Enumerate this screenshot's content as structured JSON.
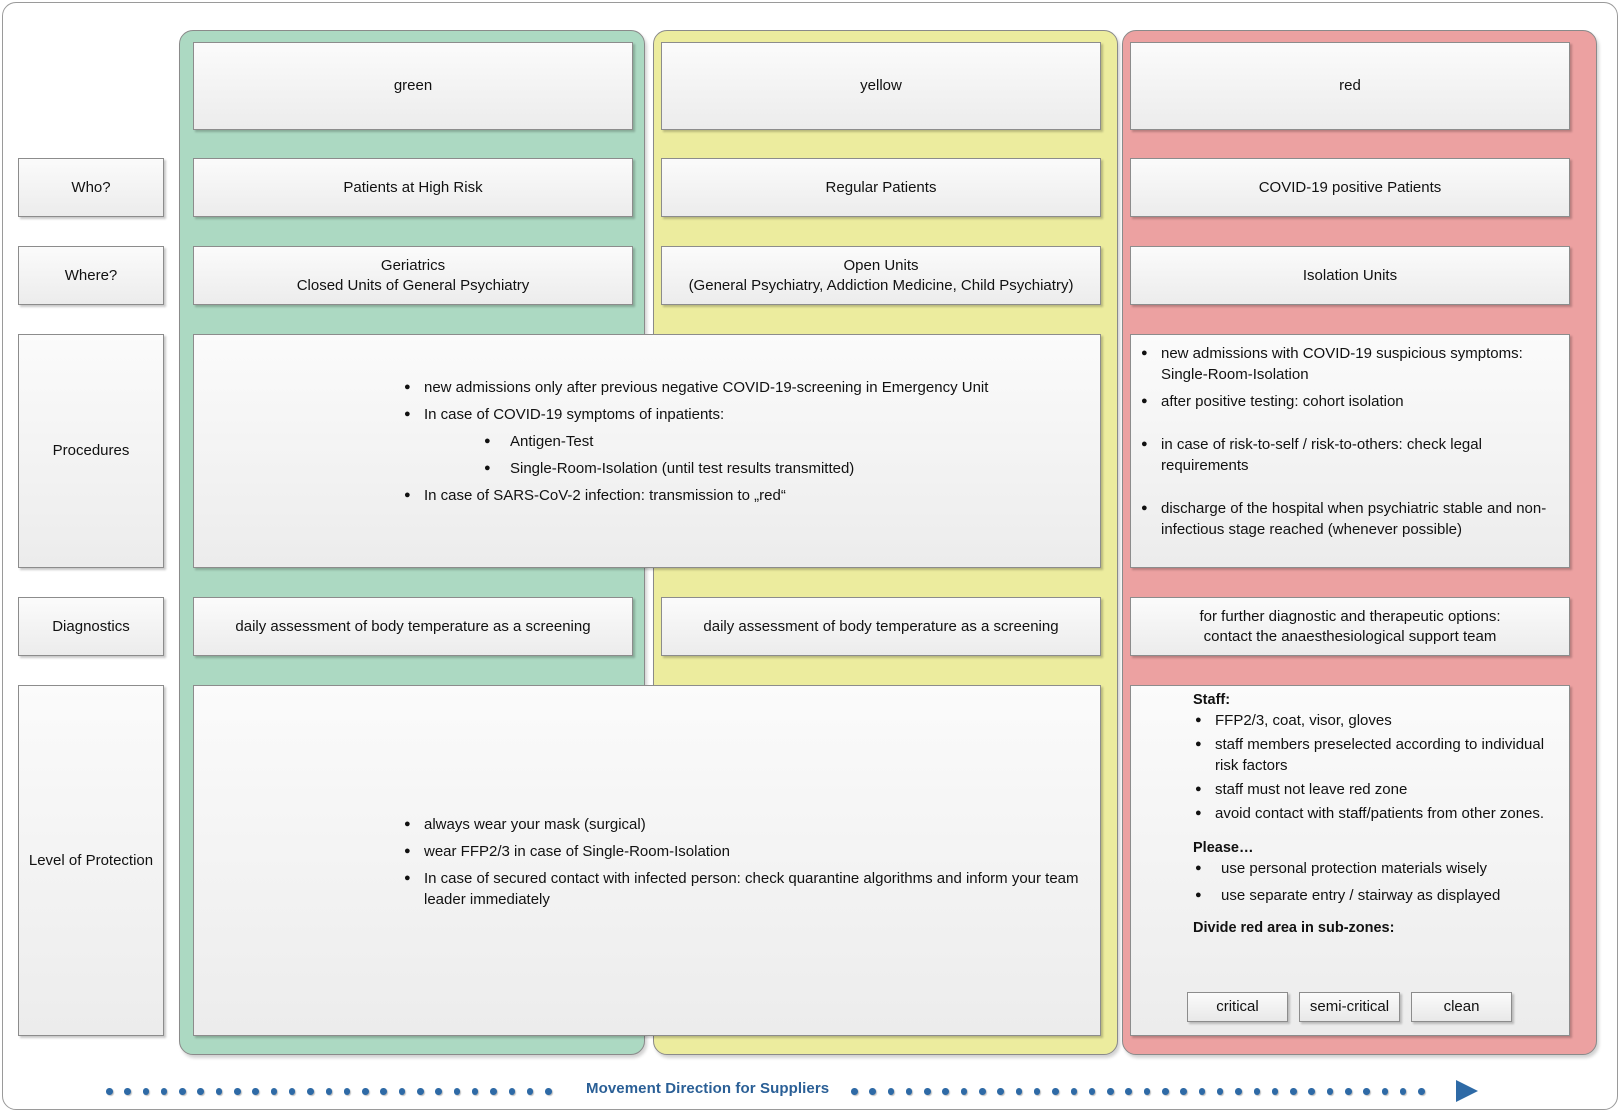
{
  "zones": {
    "green": {
      "label": "green",
      "color": "#acd9c2"
    },
    "yellow": {
      "label": "yellow",
      "color": "#ecec9e"
    },
    "red": {
      "label": "red",
      "color": "#eca1a1"
    }
  },
  "row_labels": {
    "who": "Who?",
    "where": "Where?",
    "procedures": "Procedures",
    "diagnostics": "Diagnostics",
    "protection": "Level of Protection"
  },
  "who": {
    "green": "Patients at High Risk",
    "yellow": "Regular Patients",
    "red": "COVID-19 positive Patients"
  },
  "where": {
    "green": [
      "Geriatrics",
      "Closed Units of General Psychiatry"
    ],
    "yellow": [
      "Open Units",
      "(General Psychiatry,  Addiction Medicine, Child Psychiatry)"
    ],
    "red": "Isolation Units"
  },
  "procedures": {
    "green_yellow": [
      "new admissions only after previous negative COVID-19-screening in Emergency Unit",
      "In case of COVID-19 symptoms of inpatients:",
      "Antigen-Test",
      "Single-Room-Isolation (until test results transmitted)",
      "In case of SARS-CoV-2 infection: transmission to „red“"
    ],
    "red": [
      "new admissions with COVID-19 suspicious symptoms: Single-Room-Isolation",
      "after positive testing: cohort isolation",
      "in case of risk-to-self / risk-to-others: check legal requirements",
      "discharge of the hospital when psychiatric stable and non-infectious stage reached (whenever possible)"
    ]
  },
  "diagnostics": {
    "green": "daily assessment of body temperature as a screening",
    "yellow": "daily assessment of body temperature as a screening",
    "red": [
      "for further diagnostic and therapeutic options:",
      "contact the anaesthesiological support team"
    ]
  },
  "protection": {
    "green_yellow": [
      "always wear your mask (surgical)",
      "wear FFP2/3 in case of Single-Room-Isolation",
      "In case of secured contact with infected person: check quarantine algorithms and inform your team leader immediately"
    ],
    "red": {
      "staff_heading": "Staff:",
      "staff": [
        "FFP2/3, coat, visor, gloves",
        "staff members preselected according to individual risk factors",
        "staff must not leave red zone",
        "avoid contact with staff/patients from other zones."
      ],
      "please_heading": "Please…",
      "please": [
        "use personal protection materials wisely",
        "use separate entry / stairway as displayed"
      ],
      "subzones_heading": "Divide red area in sub-zones:",
      "subzones": [
        "critical",
        "semi-critical",
        "clean"
      ]
    }
  },
  "movement": {
    "label": "Movement Direction for Suppliers",
    "icon": "arrow-right-icon",
    "color": "#2e6aa6"
  }
}
